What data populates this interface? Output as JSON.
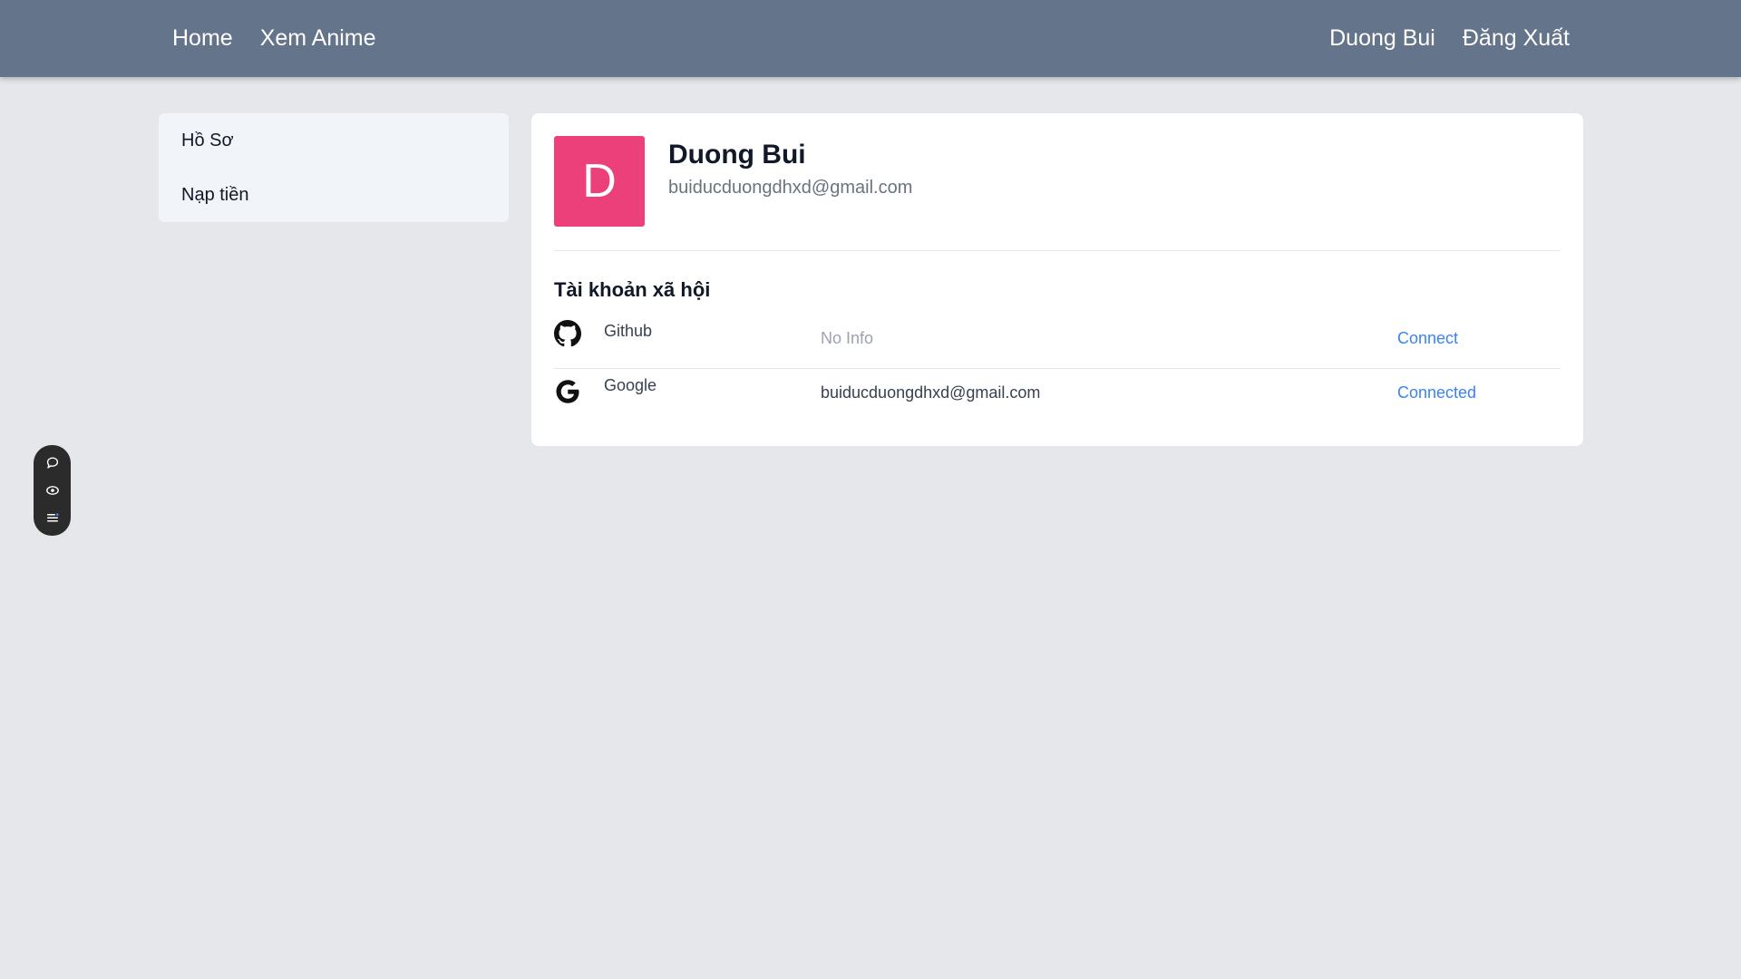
{
  "nav": {
    "home": "Home",
    "watch": "Xem Anime",
    "user": "Duong Bui",
    "logout": "Đăng Xuất"
  },
  "sidebar": {
    "items": [
      {
        "label": "Hồ Sơ"
      },
      {
        "label": "Nạp tiền"
      }
    ]
  },
  "profile": {
    "initial": "D",
    "name": "Duong Bui",
    "email": "buiducduongdhxd@gmail.com",
    "avatar_color": "#ec407a"
  },
  "social": {
    "title": "Tài khoản xã hội",
    "rows": [
      {
        "icon": "github-icon",
        "name": "Github",
        "info": "No Info",
        "action": "Connect"
      },
      {
        "icon": "google-icon",
        "name": "Google",
        "info": "buiducduongdhxd@gmail.com",
        "action": "Connected"
      }
    ]
  },
  "tools": {
    "icons": [
      "chat-bubble-icon",
      "eye-icon",
      "list-icon"
    ]
  },
  "colors": {
    "nav_bg": "#64748b",
    "page_bg": "#e5e7eb",
    "link_blue": "#3b82f6"
  }
}
